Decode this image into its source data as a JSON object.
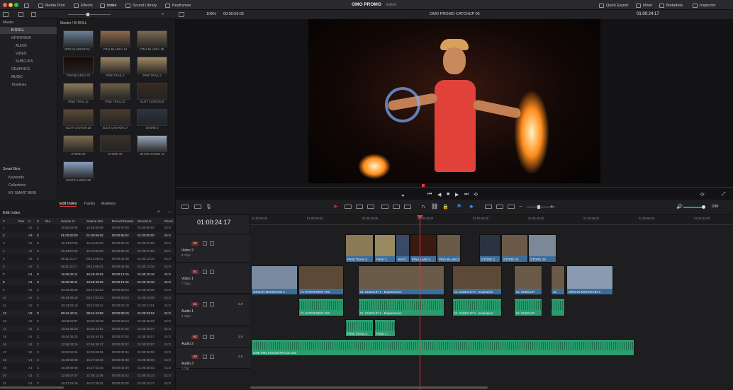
{
  "window": {
    "app_title": "OMO PROMO",
    "status": "Edited"
  },
  "topbar": {
    "media_pool": "Media Pool",
    "effects": "Effects",
    "index": "Index",
    "sound_library": "Sound Library",
    "keyframes": "Keyframes",
    "quick_export": "Quick Export",
    "mixer": "Mixer",
    "metadata": "Metadata",
    "inspector": "Inspector"
  },
  "viewer": {
    "zoom": "106%",
    "src_timecode": "00:00:56:02",
    "timeline_name": "OMO PROMO CATCHUP 05",
    "rec_timecode": "01:00:24:17"
  },
  "bins": {
    "master": "Master",
    "items": [
      "B-ROLL",
      "INTERVIEW",
      "AUDIO",
      "VIDEO",
      "SUBCLIPS",
      "GRAPHICS",
      "MUSIC",
      "Timelines"
    ],
    "smart_bins": "Smart Bins",
    "smart_items": [
      "Keywords",
      "Collections",
      "MY SMART BINS"
    ]
  },
  "pool": {
    "path": "Master / B-ROLL",
    "clips": [
      "ORGAN MOUNTAI...",
      "PINA BLANCA 44",
      "PINA BLANCA 48",
      "PINA BLANCA 70",
      "PINE TRAIL 5",
      "PINE TRAIL 8",
      "PINE TRAIL 12",
      "PINE TRAIL 20",
      "SLOT CANYON 8",
      "SLOT CANYON 16",
      "SLOT CANYON 17",
      "STORE 2",
      "STORE 28",
      "STORE 34",
      "WHITE SANDS 11",
      "WHITE SANDS 36"
    ]
  },
  "edit_index": {
    "tabs": [
      "Edit Index",
      "Tracks",
      "Markers"
    ],
    "title": "Edit Index",
    "columns": [
      "#",
      "Ree",
      "V",
      "C",
      "Dur",
      "Source In",
      "Source Out",
      "Record Duratio",
      "Record In",
      "Recor"
    ],
    "rows": [
      [
        "1",
        "",
        "V1",
        "C",
        "",
        "15:55:52:06",
        "15:55:59:06",
        "00:00:07:00",
        "01:00:00:00",
        "01:0"
      ],
      [
        "2",
        "",
        "A3",
        "C",
        "",
        "01:00:00:00",
        "01:00:56:02",
        "00:00:56:02",
        "01:00:00:00",
        "01:0"
      ],
      [
        "3",
        "",
        "V1",
        "C",
        "",
        "15:43:57:04",
        "15:44:03:20",
        "00:00:06:16",
        "01:00:07:03",
        "01:0"
      ],
      [
        "4",
        "",
        "A1",
        "C",
        "",
        "15:43:57:04",
        "15:44:03:20",
        "00:00:06:16",
        "01:00:07:03",
        "01:0"
      ],
      [
        "5",
        "",
        "V2",
        "C",
        "",
        "05:11:01:17",
        "05:11:06:01",
        "00:00:04:08",
        "01:00:13:16",
        "01:0"
      ],
      [
        "6",
        "",
        "A2",
        "C",
        "",
        "05:11:01:17",
        "05:11:06:01",
        "00:00:04:08",
        "01:00:13:16",
        "01:0"
      ],
      [
        "7",
        "",
        "V1",
        "C",
        "",
        "16:26:32:11",
        "16:26:45:02",
        "00:00:12:15",
        "01:00:15:16",
        "01:0"
      ],
      [
        "8",
        "",
        "A1",
        "C",
        "",
        "16:26:32:11",
        "16:26:45:02",
        "00:00:12:15",
        "01:00:15:16",
        "01:0"
      ],
      [
        "9",
        "",
        "V2",
        "C",
        "",
        "03:16:59:19",
        "03:17:02:22",
        "00:00:03:03",
        "01:00:18:00",
        "01:0"
      ],
      [
        "10",
        "",
        "A2",
        "C",
        "",
        "05:19:59:19",
        "03:17:02:22",
        "00:00:03:03",
        "01:00:18:00",
        "01:0"
      ],
      [
        "11",
        "",
        "V2",
        "C",
        "",
        "20:13:03:16",
        "20:13:06:11",
        "00:00:02:19",
        "01:00:21:01",
        "01:0"
      ],
      [
        "12",
        "",
        "V2",
        "C",
        "",
        "08:41:40:11",
        "08:41:43:58",
        "00:00:03:19",
        "01:00:23:04",
        "01:0"
      ],
      [
        "13",
        "",
        "V2",
        "C",
        "",
        "19:03:22:07",
        "19:03:25:48",
        "00:00:03:13",
        "01:00:26:23",
        "01:0"
      ],
      [
        "14",
        "",
        "V1",
        "C",
        "",
        "15:54:36:23",
        "15:54:44:01",
        "00:00:07:02",
        "01:00:29:07",
        "01:0"
      ],
      [
        "15",
        "",
        "A1",
        "C",
        "",
        "15:54:36:23",
        "15:54:44:01",
        "00:00:07:02",
        "01:00:29:07",
        "01:0"
      ],
      [
        "16",
        "",
        "V2",
        "C",
        "",
        "22:56:33:15",
        "22:56:38:17",
        "00:00:03:02",
        "01:00:33:07",
        "01:0"
      ],
      [
        "17",
        "",
        "V2",
        "C",
        "",
        "16:02:02:21",
        "16:02:06:01",
        "00:00:04:04",
        "01:00:36:09",
        "01:0"
      ],
      [
        "18",
        "",
        "V1",
        "C",
        "",
        "16:26:59:08",
        "16:27:02:16",
        "00:00:04:08",
        "01:00:38:03",
        "01:0"
      ],
      [
        "19",
        "",
        "A1",
        "C",
        "",
        "16:26:59:08",
        "16:27:02:16",
        "00:00:04:08",
        "01:00:38:03",
        "01:0"
      ],
      [
        "20",
        "",
        "V1",
        "C",
        "",
        "22:06:07:07",
        "22:06:11:09",
        "00:00:04:02",
        "01:00:40:13",
        "01:0"
      ],
      [
        "21",
        "",
        "V1",
        "C",
        "",
        "16:27:16:16",
        "16:27:20:21",
        "00:00:02:05",
        "01:00:43:17",
        "01:0"
      ]
    ]
  },
  "timeline": {
    "timecode": "01:00:24:17",
    "ruler": [
      "01:00:00:00",
      "01:00:08:00",
      "01:00:16:00",
      "01:00:24:00",
      "01:00:32:00",
      "01:00:40:00",
      "01:00:48:00",
      "01:00:56:00",
      "01:01:04:00"
    ],
    "tracks": [
      {
        "id": "V2",
        "name": "Video 2",
        "sub": "8 Clips"
      },
      {
        "id": "V1",
        "name": "Video 1",
        "sub": "7 Clips"
      },
      {
        "id": "A1",
        "name": "Audio 1",
        "sub": "3 Clips",
        "level": "2.0"
      },
      {
        "id": "A2",
        "name": "Audio 2",
        "sub": "2 Clips",
        "level": "2.0"
      },
      {
        "id": "A3",
        "name": "Audio 3",
        "sub": "1 Clip",
        "level": "2.0"
      }
    ],
    "v2_clips": [
      "PINE TRAIL 5",
      "PINE T...",
      "WHIT...",
      "PINA LANCA ...",
      "PINA BLANCA ...",
      "STORE 2",
      "STORE 34",
      "STORE 28"
    ],
    "v1_clips": [
      "ORGAN MOUNTAIN 1",
      "CL INTERVIEW TK2",
      "CL SUBCLIP 1 - Experiences",
      "CL SUBCLIP 4 - Inspiration",
      "CL SUBCLIP",
      "CL",
      "ORGAN MOUNTAIN 1"
    ],
    "a1_clips": [
      "CL INTERVIEW TK2",
      "CL SUBCLIP 1 - Experiences",
      "CL SUBCLIP 4 - Inspiration",
      "CL SUBCLIP",
      ""
    ],
    "a2_clips": [
      "PINE TRAIL 5",
      "PINE T..."
    ],
    "a3_clip": "ONE MIN SOUNDTRACK.wav",
    "audio_label": "DIM"
  },
  "colors": {
    "accent_red": "#e03a3a",
    "video_clip": "#3c6e9c",
    "audio_clip": "#2a9d6e",
    "playhead": "#e03a3a"
  }
}
